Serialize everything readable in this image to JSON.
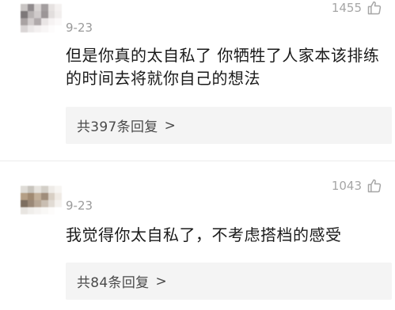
{
  "comments": [
    {
      "date": "9-23",
      "likes": "1455",
      "text": "但是你真的太自私了 你牺牲了人家本该排练的时间去将就你自己的想法",
      "reply_prefix": "共397条回复",
      "reply_arrow": ">"
    },
    {
      "date": "9-23",
      "likes": "1043",
      "text": "我觉得你太自私了，不考虑搭档的感受",
      "reply_prefix": "共84条回复",
      "reply_arrow": ">"
    }
  ],
  "icons": {
    "like": "thumbs-up-icon",
    "avatar": "blurred-avatar"
  },
  "colors": {
    "text": "#1a1a1a",
    "meta": "#9a9a9a",
    "reply_bg": "#f4f4f4"
  }
}
